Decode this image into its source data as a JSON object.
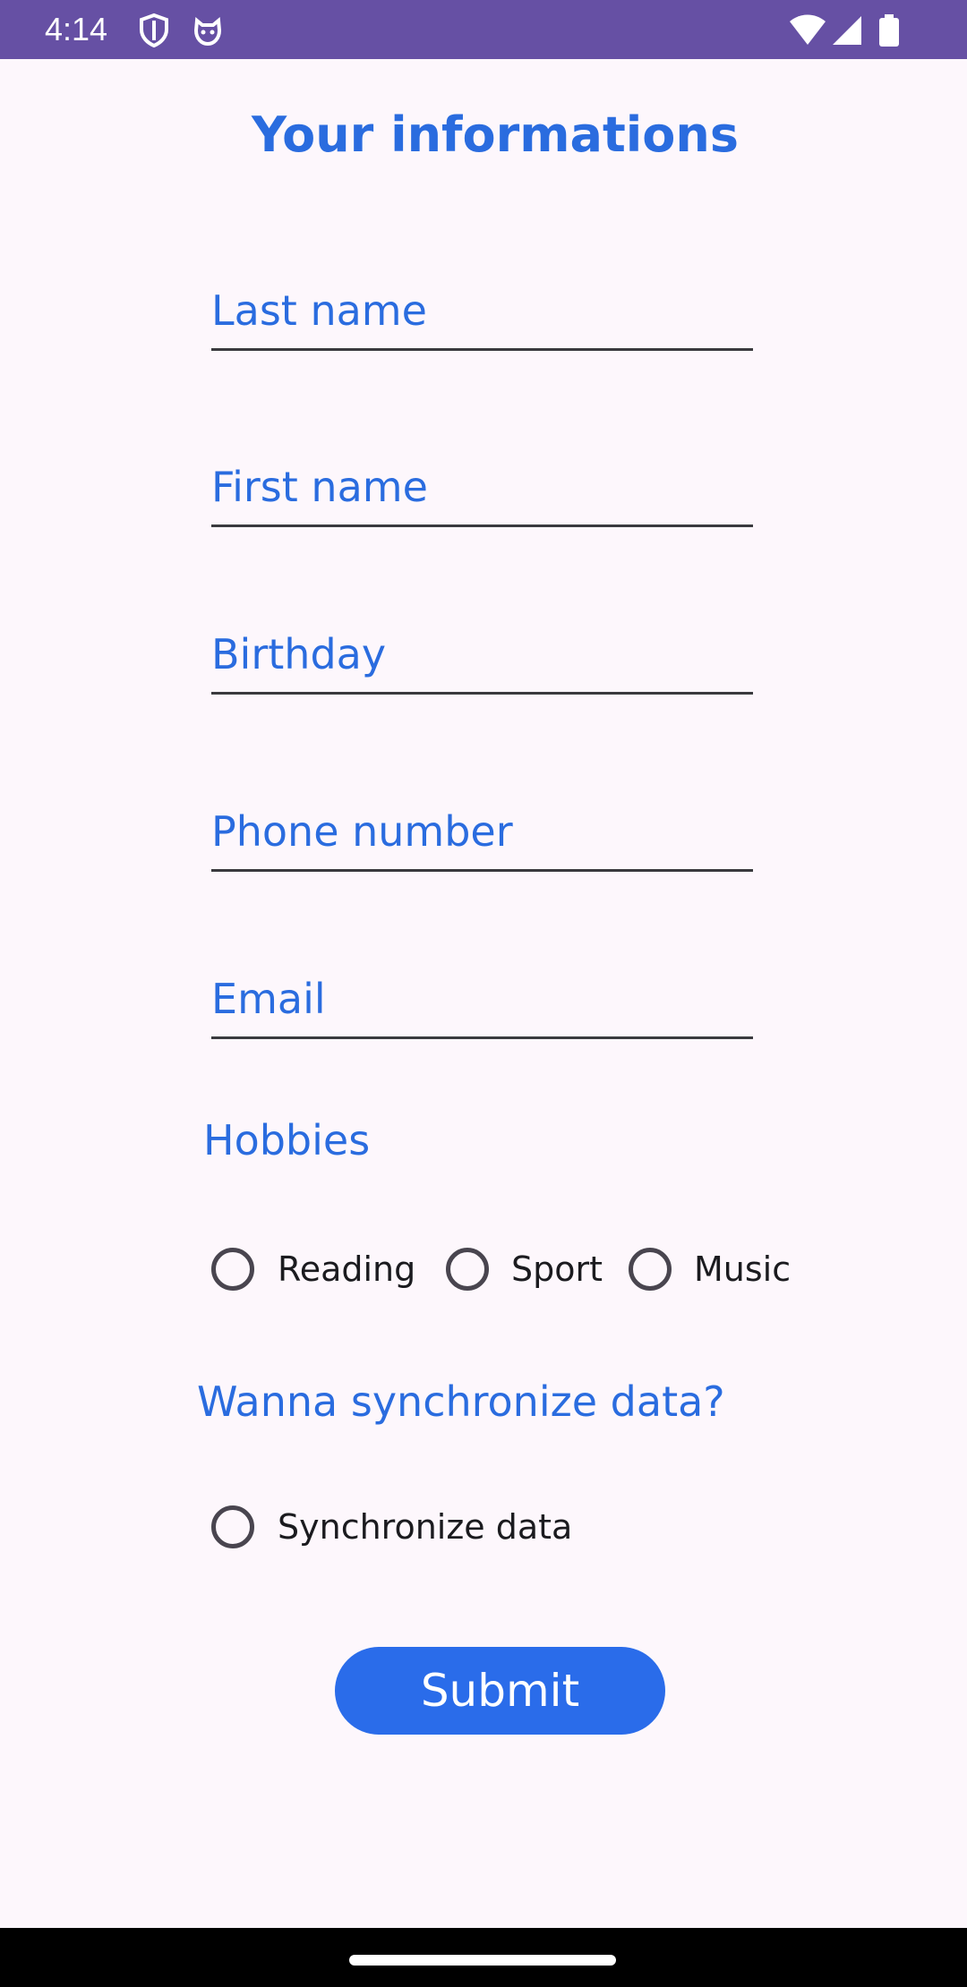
{
  "status_bar": {
    "time": "4:14",
    "icons": [
      "shield-icon",
      "cat-face-icon",
      "wifi-icon",
      "cellular-signal-icon",
      "battery-icon"
    ],
    "background": "#6650a4"
  },
  "page": {
    "title": "Your informations",
    "accent_color": "#2a6cdf"
  },
  "form": {
    "fields": {
      "last_name": {
        "placeholder": "Last name",
        "value": ""
      },
      "first_name": {
        "placeholder": "First name",
        "value": ""
      },
      "birthday": {
        "placeholder": "Birthday",
        "value": ""
      },
      "phone": {
        "placeholder": "Phone number",
        "value": ""
      },
      "email": {
        "placeholder": "Email",
        "value": ""
      }
    },
    "hobbies": {
      "label": "Hobbies",
      "options": [
        {
          "label": "Reading",
          "checked": false
        },
        {
          "label": "Sport",
          "checked": false
        },
        {
          "label": "Music",
          "checked": false
        }
      ]
    },
    "sync": {
      "label": "Wanna synchronize data?",
      "option_label": "Synchronize data",
      "checked": false
    },
    "submit_label": "Submit"
  }
}
